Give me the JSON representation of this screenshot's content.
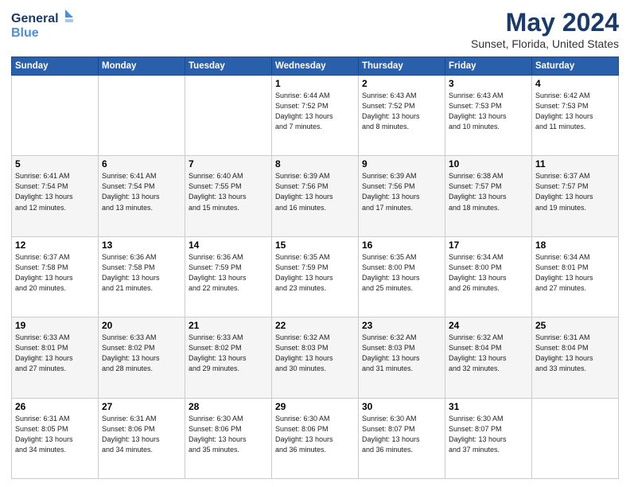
{
  "app": {
    "logo_line1": "General",
    "logo_line2": "Blue"
  },
  "header": {
    "title": "May 2024",
    "subtitle": "Sunset, Florida, United States"
  },
  "weekdays": [
    "Sunday",
    "Monday",
    "Tuesday",
    "Wednesday",
    "Thursday",
    "Friday",
    "Saturday"
  ],
  "weeks": [
    [
      {
        "day": "",
        "info": ""
      },
      {
        "day": "",
        "info": ""
      },
      {
        "day": "",
        "info": ""
      },
      {
        "day": "1",
        "info": "Sunrise: 6:44 AM\nSunset: 7:52 PM\nDaylight: 13 hours\nand 7 minutes."
      },
      {
        "day": "2",
        "info": "Sunrise: 6:43 AM\nSunset: 7:52 PM\nDaylight: 13 hours\nand 8 minutes."
      },
      {
        "day": "3",
        "info": "Sunrise: 6:43 AM\nSunset: 7:53 PM\nDaylight: 13 hours\nand 10 minutes."
      },
      {
        "day": "4",
        "info": "Sunrise: 6:42 AM\nSunset: 7:53 PM\nDaylight: 13 hours\nand 11 minutes."
      }
    ],
    [
      {
        "day": "5",
        "info": "Sunrise: 6:41 AM\nSunset: 7:54 PM\nDaylight: 13 hours\nand 12 minutes."
      },
      {
        "day": "6",
        "info": "Sunrise: 6:41 AM\nSunset: 7:54 PM\nDaylight: 13 hours\nand 13 minutes."
      },
      {
        "day": "7",
        "info": "Sunrise: 6:40 AM\nSunset: 7:55 PM\nDaylight: 13 hours\nand 15 minutes."
      },
      {
        "day": "8",
        "info": "Sunrise: 6:39 AM\nSunset: 7:56 PM\nDaylight: 13 hours\nand 16 minutes."
      },
      {
        "day": "9",
        "info": "Sunrise: 6:39 AM\nSunset: 7:56 PM\nDaylight: 13 hours\nand 17 minutes."
      },
      {
        "day": "10",
        "info": "Sunrise: 6:38 AM\nSunset: 7:57 PM\nDaylight: 13 hours\nand 18 minutes."
      },
      {
        "day": "11",
        "info": "Sunrise: 6:37 AM\nSunset: 7:57 PM\nDaylight: 13 hours\nand 19 minutes."
      }
    ],
    [
      {
        "day": "12",
        "info": "Sunrise: 6:37 AM\nSunset: 7:58 PM\nDaylight: 13 hours\nand 20 minutes."
      },
      {
        "day": "13",
        "info": "Sunrise: 6:36 AM\nSunset: 7:58 PM\nDaylight: 13 hours\nand 21 minutes."
      },
      {
        "day": "14",
        "info": "Sunrise: 6:36 AM\nSunset: 7:59 PM\nDaylight: 13 hours\nand 22 minutes."
      },
      {
        "day": "15",
        "info": "Sunrise: 6:35 AM\nSunset: 7:59 PM\nDaylight: 13 hours\nand 23 minutes."
      },
      {
        "day": "16",
        "info": "Sunrise: 6:35 AM\nSunset: 8:00 PM\nDaylight: 13 hours\nand 25 minutes."
      },
      {
        "day": "17",
        "info": "Sunrise: 6:34 AM\nSunset: 8:00 PM\nDaylight: 13 hours\nand 26 minutes."
      },
      {
        "day": "18",
        "info": "Sunrise: 6:34 AM\nSunset: 8:01 PM\nDaylight: 13 hours\nand 27 minutes."
      }
    ],
    [
      {
        "day": "19",
        "info": "Sunrise: 6:33 AM\nSunset: 8:01 PM\nDaylight: 13 hours\nand 27 minutes."
      },
      {
        "day": "20",
        "info": "Sunrise: 6:33 AM\nSunset: 8:02 PM\nDaylight: 13 hours\nand 28 minutes."
      },
      {
        "day": "21",
        "info": "Sunrise: 6:33 AM\nSunset: 8:02 PM\nDaylight: 13 hours\nand 29 minutes."
      },
      {
        "day": "22",
        "info": "Sunrise: 6:32 AM\nSunset: 8:03 PM\nDaylight: 13 hours\nand 30 minutes."
      },
      {
        "day": "23",
        "info": "Sunrise: 6:32 AM\nSunset: 8:03 PM\nDaylight: 13 hours\nand 31 minutes."
      },
      {
        "day": "24",
        "info": "Sunrise: 6:32 AM\nSunset: 8:04 PM\nDaylight: 13 hours\nand 32 minutes."
      },
      {
        "day": "25",
        "info": "Sunrise: 6:31 AM\nSunset: 8:04 PM\nDaylight: 13 hours\nand 33 minutes."
      }
    ],
    [
      {
        "day": "26",
        "info": "Sunrise: 6:31 AM\nSunset: 8:05 PM\nDaylight: 13 hours\nand 34 minutes."
      },
      {
        "day": "27",
        "info": "Sunrise: 6:31 AM\nSunset: 8:06 PM\nDaylight: 13 hours\nand 34 minutes."
      },
      {
        "day": "28",
        "info": "Sunrise: 6:30 AM\nSunset: 8:06 PM\nDaylight: 13 hours\nand 35 minutes."
      },
      {
        "day": "29",
        "info": "Sunrise: 6:30 AM\nSunset: 8:06 PM\nDaylight: 13 hours\nand 36 minutes."
      },
      {
        "day": "30",
        "info": "Sunrise: 6:30 AM\nSunset: 8:07 PM\nDaylight: 13 hours\nand 36 minutes."
      },
      {
        "day": "31",
        "info": "Sunrise: 6:30 AM\nSunset: 8:07 PM\nDaylight: 13 hours\nand 37 minutes."
      },
      {
        "day": "",
        "info": ""
      }
    ]
  ]
}
